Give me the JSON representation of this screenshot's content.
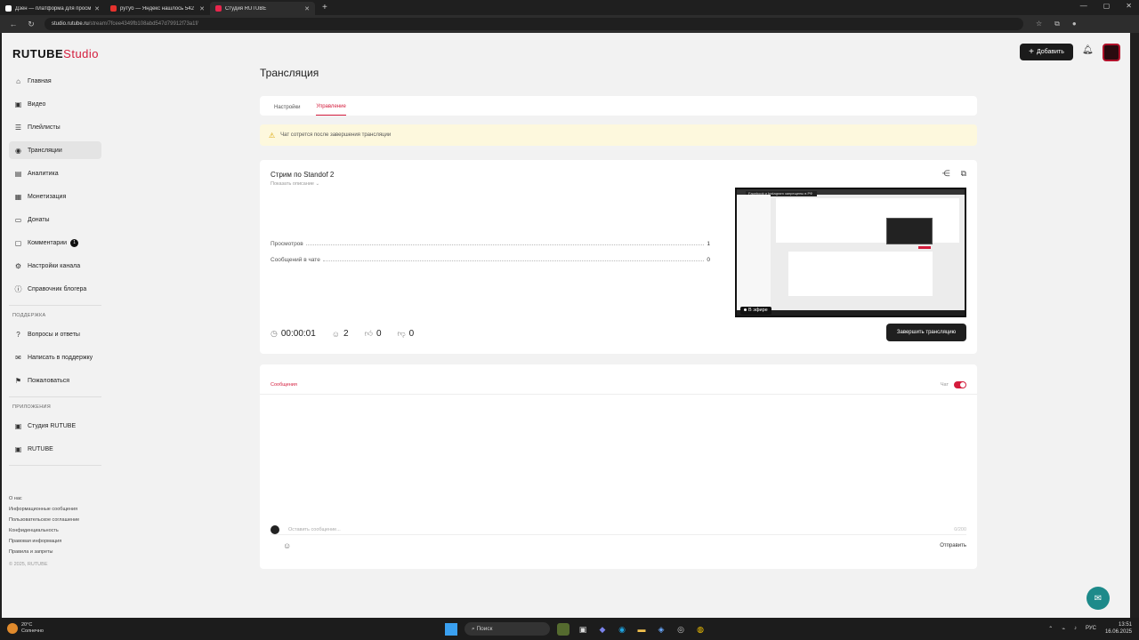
{
  "browser": {
    "tabs": [
      {
        "title": "Дзен — платформа для просм...",
        "favicon_color": "#ffffff",
        "active": false
      },
      {
        "title": "рутуб — Яндекс нашлось 542 р...",
        "favicon_color": "#e5322d",
        "active": false
      },
      {
        "title": "Студия RUTUBE",
        "favicon_color": "#e8264d",
        "active": true
      }
    ],
    "new_tab": "+",
    "url_host": "studio.rutube.ru",
    "url_path": "/stream/7fcee4349fb108abd547d79912f73a1f/"
  },
  "app": {
    "logo_main": "RUTUBE",
    "logo_sub": "Studio",
    "add_button": "Добавить"
  },
  "sidebar": {
    "items": [
      {
        "label": "Главная",
        "icon": "home-icon",
        "glyph": "⌂"
      },
      {
        "label": "Видео",
        "icon": "video-icon",
        "glyph": "▣"
      },
      {
        "label": "Плейлисты",
        "icon": "playlist-icon",
        "glyph": "☰"
      },
      {
        "label": "Трансляции",
        "icon": "broadcast-icon",
        "glyph": "◉"
      },
      {
        "label": "Аналитика",
        "icon": "analytics-icon",
        "glyph": "▤"
      },
      {
        "label": "Монетизация",
        "icon": "money-icon",
        "glyph": "▦"
      },
      {
        "label": "Донаты",
        "icon": "donate-icon",
        "glyph": "▭"
      },
      {
        "label": "Комментарии",
        "icon": "comments-icon",
        "glyph": "▢",
        "badge": "1"
      },
      {
        "label": "Настройки канала",
        "icon": "settings-icon",
        "glyph": "⚙"
      },
      {
        "label": "Справочник блогера",
        "icon": "info-icon",
        "glyph": "ⓘ"
      }
    ],
    "support_title": "ПОДДЕРЖКА",
    "support_items": [
      {
        "label": "Вопросы и ответы",
        "icon": "question-icon",
        "glyph": "?"
      },
      {
        "label": "Написать в поддержку",
        "icon": "mail-icon",
        "glyph": "✉"
      },
      {
        "label": "Пожаловаться",
        "icon": "flag-icon",
        "glyph": "⚑"
      }
    ],
    "apps_title": "ПРИЛОЖЕНИЯ",
    "apps_items": [
      {
        "label": "Студия RUTUBE",
        "icon": "studio-app-icon",
        "glyph": "▣"
      },
      {
        "label": "RUTUBE",
        "icon": "rutube-app-icon",
        "glyph": "▣"
      }
    ],
    "footer": [
      "О нас",
      "Информационные сообщения",
      "Пользовательское соглашение",
      "Конфиденциальность",
      "Правовая информация",
      "Правила и запреты"
    ],
    "copyright": "© 2025, RUTUBE"
  },
  "main": {
    "page_title": "Трансляция",
    "tabs": [
      "Настройки",
      "Управление"
    ],
    "active_tab": 1,
    "warning": "Чат сотрется после завершения трансляции",
    "stream": {
      "title": "Стрим по Standof 2",
      "subtitle": "Показать описание",
      "stats": [
        {
          "label": "Просмотров",
          "value": "1"
        },
        {
          "label": "Сообщений в чате",
          "value": "0"
        }
      ],
      "timer": "00:00:01",
      "viewers": "2",
      "likes": "0",
      "dislikes": "0",
      "preview_banner": "Facebook и Instagram запрещены в РФ",
      "live_label": "В эфире",
      "end_button": "Завершить трансляцию"
    },
    "chat": {
      "heading": "Сообщения",
      "toggle_label": "Чат",
      "toggle_on": true,
      "placeholder": "Оставить сообщение...",
      "counter": "0/200",
      "send": "Отправить"
    }
  },
  "taskbar": {
    "weather_temp": "20°C",
    "weather_desc": "Солнечно",
    "search": "Поиск",
    "lang": "РУС",
    "time": "13:51",
    "date": "16.06.2025"
  }
}
